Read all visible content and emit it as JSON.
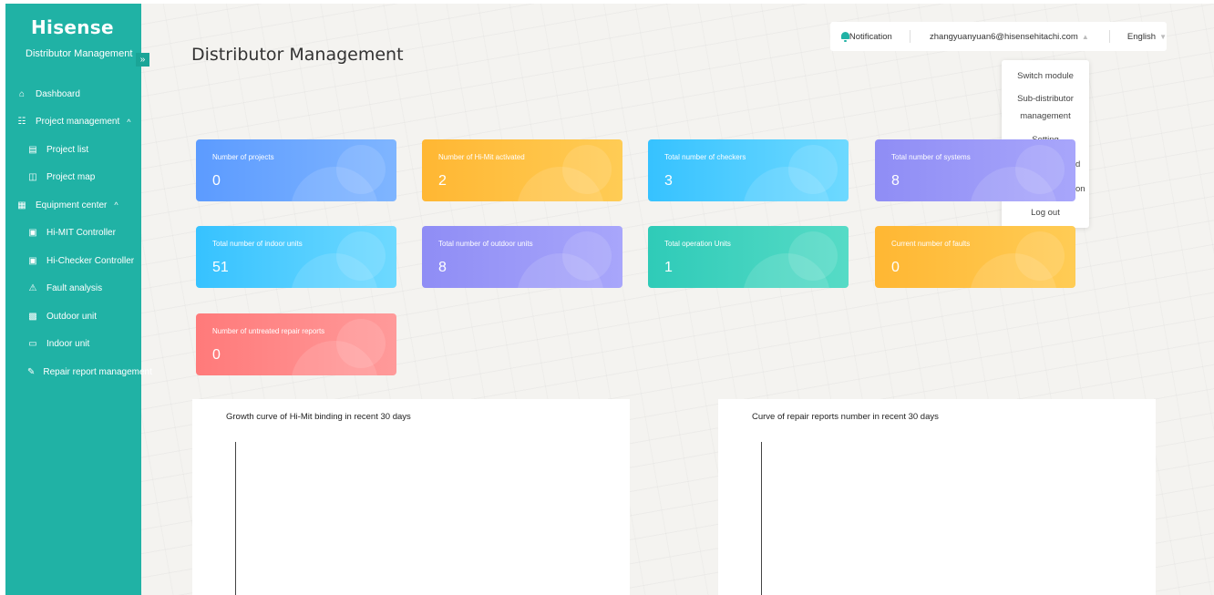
{
  "sidebar": {
    "brand": "Hisense",
    "subtitle": "Distributor Management",
    "collapse_icon": "»",
    "items": [
      {
        "label": "Dashboard",
        "icon": "⌂",
        "level": 1
      },
      {
        "label": "Project management",
        "icon": "☷",
        "level": 1,
        "caret": "^"
      },
      {
        "label": "Project list",
        "icon": "▤",
        "level": 2
      },
      {
        "label": "Project map",
        "icon": "◫",
        "level": 2
      },
      {
        "label": "Equipment center",
        "icon": "▦",
        "level": 1,
        "caret": "^"
      },
      {
        "label": "Hi-MIT Controller",
        "icon": "▣",
        "level": 2
      },
      {
        "label": "Hi-Checker Controller",
        "icon": "▣",
        "level": 2
      },
      {
        "label": "Fault analysis",
        "icon": "⚠",
        "level": 2
      },
      {
        "label": "Outdoor unit",
        "icon": "▩",
        "level": 2
      },
      {
        "label": "Indoor unit",
        "icon": "▭",
        "level": 2
      },
      {
        "label": "Repair report management",
        "icon": "✎",
        "level": 2
      }
    ]
  },
  "header": {
    "title": "Distributor Management",
    "notification": "Notification",
    "user_email": "zhangyuanyuan6@hisensehitachi.com",
    "language": "English"
  },
  "user_menu": [
    "Switch module",
    "Sub-distributor",
    "management",
    "Setting",
    "Change password",
    "Personal information",
    "Log out"
  ],
  "cards": [
    {
      "label": "Number of projects",
      "value": "0",
      "color": "blue"
    },
    {
      "label": "Number of Hi-Mit activated",
      "value": "2",
      "color": "orange"
    },
    {
      "label": "Total number of checkers",
      "value": "3",
      "color": "cyan"
    },
    {
      "label": "Total number of systems",
      "value": "8",
      "color": "purple"
    },
    {
      "label": "Total number of indoor units",
      "value": "51",
      "color": "cyan"
    },
    {
      "label": "Total number of outdoor units",
      "value": "8",
      "color": "purple"
    },
    {
      "label": "Total operation Units",
      "value": "1",
      "color": "teal"
    },
    {
      "label": "Current number of faults",
      "value": "0",
      "color": "orange"
    },
    {
      "label": "Number of untreated repair reports",
      "value": "0",
      "color": "red"
    }
  ],
  "charts": [
    {
      "title": "Growth curve of Hi-Mit binding in recent 30 days"
    },
    {
      "title": "Curve of repair reports number in recent 30 days"
    }
  ]
}
